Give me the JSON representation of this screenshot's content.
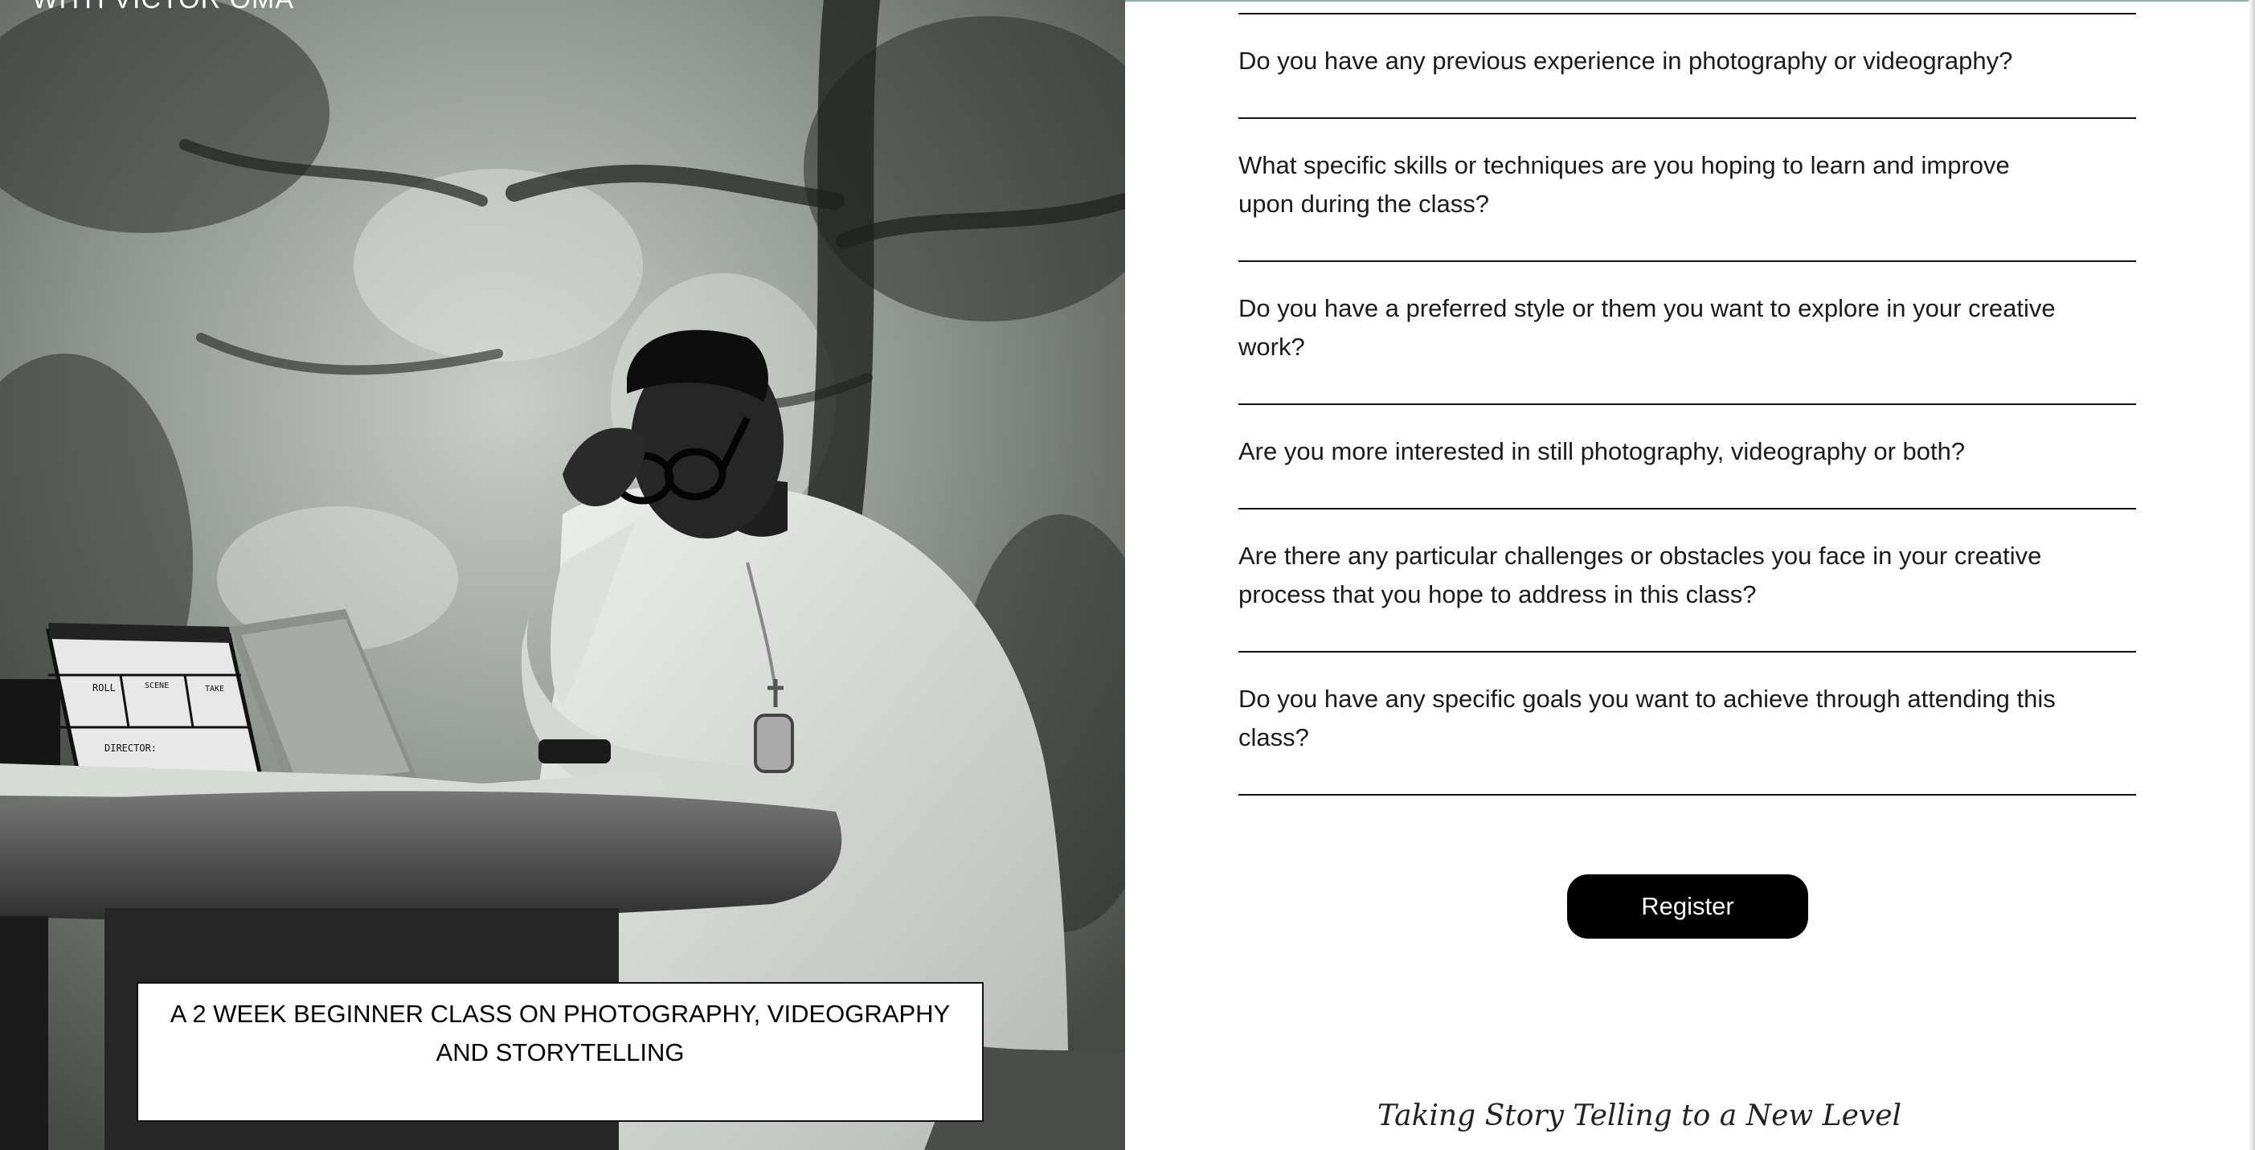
{
  "hero": {
    "top_text": "WITH VICTOR OMA",
    "caption": "A 2 WEEK BEGINNER CLASS ON PHOTOGRAPHY, VIDEOGRAPHY AND STORYTELLING",
    "clapper": {
      "roll": "ROLL",
      "scene": "SCENE",
      "take": "TAKE",
      "director": "DIRECTOR:"
    }
  },
  "form": {
    "questions": [
      {
        "label": "Do you have any previous experience in photography or videography?",
        "value": ""
      },
      {
        "label": "What specific skills or techniques are you hoping to learn and improve upon during the class?",
        "value": ""
      },
      {
        "label": "Do you have a preferred style or them you want to explore in your creative work?",
        "value": ""
      },
      {
        "label": "Are you more interested in still photography, videography or both?",
        "value": ""
      },
      {
        "label": "Are there any particular challenges or obstacles you face in your creative process that you hope to address in this class?",
        "value": ""
      },
      {
        "label": "Do you have any specific goals you want to achieve through attending this class?",
        "value": ""
      }
    ],
    "submit_label": "Register"
  },
  "footer": {
    "tagline": "Taking Story Telling to a New Level"
  }
}
